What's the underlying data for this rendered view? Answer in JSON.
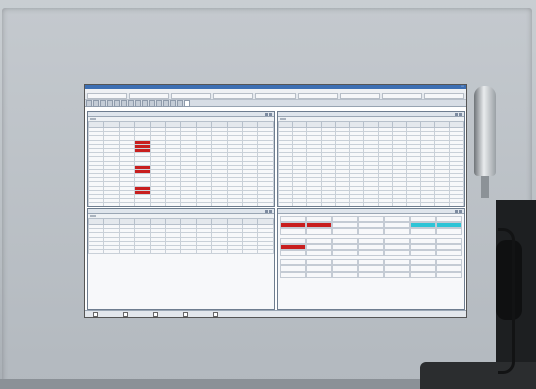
{
  "app": {
    "title": "",
    "menu": [
      "",
      "",
      "",
      "",
      "",
      "",
      "",
      ""
    ]
  },
  "toolbar": [
    "",
    "",
    "",
    "",
    "",
    "",
    "",
    "",
    ""
  ],
  "tabs": [
    "",
    "",
    "",
    "",
    "",
    "",
    "",
    "",
    "",
    "",
    "",
    "",
    "",
    "",
    ""
  ],
  "panes": {
    "top_left": {
      "title": "",
      "tab": ""
    },
    "top_right": {
      "title": "",
      "tab": ""
    },
    "bottom_left": {
      "title": "",
      "tab": ""
    },
    "bottom_right": {
      "title": ""
    }
  },
  "statusbar": [
    "",
    "",
    "",
    "",
    ""
  ],
  "colors": {
    "alarm_red": "#c81e1e",
    "ok_green": "#2fa14a",
    "cyan": "#2ec4d6",
    "title_blue": "#3d6fb3"
  }
}
